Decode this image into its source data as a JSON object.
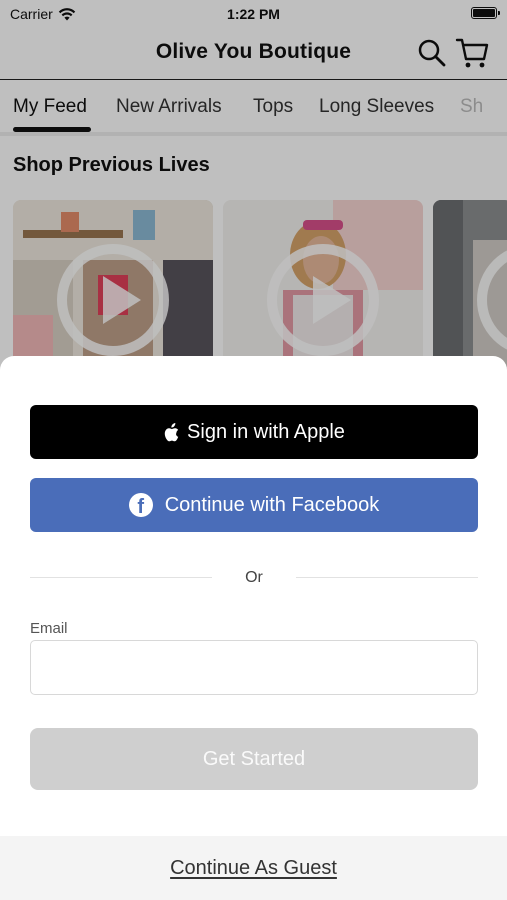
{
  "status_bar": {
    "carrier": "Carrier",
    "time": "1:22 PM",
    "battery_level": 1.0,
    "icons": [
      "wifi-icon",
      "battery-icon"
    ]
  },
  "nav": {
    "title": "Olive You Boutique",
    "icons": [
      "search-icon",
      "cart-icon"
    ]
  },
  "tabs": [
    {
      "label": "My Feed",
      "active": true
    },
    {
      "label": "New Arrivals",
      "active": false
    },
    {
      "label": "Tops",
      "active": false
    },
    {
      "label": "Long Sleeves",
      "active": false
    },
    {
      "label": "Sh",
      "active": false
    }
  ],
  "section": {
    "title": "Shop Previous Lives",
    "cards": [
      {
        "icon": "play-icon"
      },
      {
        "icon": "play-icon"
      },
      {
        "icon": "play-icon"
      }
    ]
  },
  "sheet": {
    "apple_label": "Sign in with Apple",
    "facebook_label": "Continue with Facebook",
    "or_text": "Or",
    "email_label": "Email",
    "email_value": "",
    "email_placeholder": "",
    "get_started_label": "Get Started",
    "guest_label": "Continue As Guest"
  },
  "colors": {
    "apple_button": "#000000",
    "facebook_button": "#4a6db9",
    "disabled_button": "#cfcfcf",
    "guest_bar": "#f4f4f4"
  }
}
